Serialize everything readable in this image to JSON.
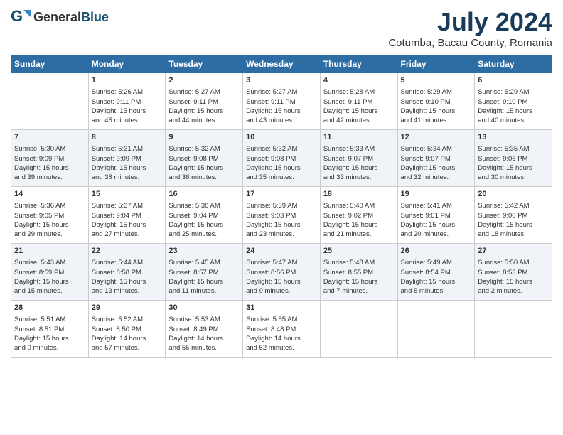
{
  "header": {
    "logo_general": "General",
    "logo_blue": "Blue",
    "title": "July 2024",
    "location": "Cotumba, Bacau County, Romania"
  },
  "days_of_week": [
    "Sunday",
    "Monday",
    "Tuesday",
    "Wednesday",
    "Thursday",
    "Friday",
    "Saturday"
  ],
  "weeks": [
    [
      {
        "day": "",
        "content": ""
      },
      {
        "day": "1",
        "content": "Sunrise: 5:26 AM\nSunset: 9:11 PM\nDaylight: 15 hours\nand 45 minutes."
      },
      {
        "day": "2",
        "content": "Sunrise: 5:27 AM\nSunset: 9:11 PM\nDaylight: 15 hours\nand 44 minutes."
      },
      {
        "day": "3",
        "content": "Sunrise: 5:27 AM\nSunset: 9:11 PM\nDaylight: 15 hours\nand 43 minutes."
      },
      {
        "day": "4",
        "content": "Sunrise: 5:28 AM\nSunset: 9:11 PM\nDaylight: 15 hours\nand 42 minutes."
      },
      {
        "day": "5",
        "content": "Sunrise: 5:29 AM\nSunset: 9:10 PM\nDaylight: 15 hours\nand 41 minutes."
      },
      {
        "day": "6",
        "content": "Sunrise: 5:29 AM\nSunset: 9:10 PM\nDaylight: 15 hours\nand 40 minutes."
      }
    ],
    [
      {
        "day": "7",
        "content": "Sunrise: 5:30 AM\nSunset: 9:09 PM\nDaylight: 15 hours\nand 39 minutes."
      },
      {
        "day": "8",
        "content": "Sunrise: 5:31 AM\nSunset: 9:09 PM\nDaylight: 15 hours\nand 38 minutes."
      },
      {
        "day": "9",
        "content": "Sunrise: 5:32 AM\nSunset: 9:08 PM\nDaylight: 15 hours\nand 36 minutes."
      },
      {
        "day": "10",
        "content": "Sunrise: 5:32 AM\nSunset: 9:08 PM\nDaylight: 15 hours\nand 35 minutes."
      },
      {
        "day": "11",
        "content": "Sunrise: 5:33 AM\nSunset: 9:07 PM\nDaylight: 15 hours\nand 33 minutes."
      },
      {
        "day": "12",
        "content": "Sunrise: 5:34 AM\nSunset: 9:07 PM\nDaylight: 15 hours\nand 32 minutes."
      },
      {
        "day": "13",
        "content": "Sunrise: 5:35 AM\nSunset: 9:06 PM\nDaylight: 15 hours\nand 30 minutes."
      }
    ],
    [
      {
        "day": "14",
        "content": "Sunrise: 5:36 AM\nSunset: 9:05 PM\nDaylight: 15 hours\nand 29 minutes."
      },
      {
        "day": "15",
        "content": "Sunrise: 5:37 AM\nSunset: 9:04 PM\nDaylight: 15 hours\nand 27 minutes."
      },
      {
        "day": "16",
        "content": "Sunrise: 5:38 AM\nSunset: 9:04 PM\nDaylight: 15 hours\nand 25 minutes."
      },
      {
        "day": "17",
        "content": "Sunrise: 5:39 AM\nSunset: 9:03 PM\nDaylight: 15 hours\nand 23 minutes."
      },
      {
        "day": "18",
        "content": "Sunrise: 5:40 AM\nSunset: 9:02 PM\nDaylight: 15 hours\nand 21 minutes."
      },
      {
        "day": "19",
        "content": "Sunrise: 5:41 AM\nSunset: 9:01 PM\nDaylight: 15 hours\nand 20 minutes."
      },
      {
        "day": "20",
        "content": "Sunrise: 5:42 AM\nSunset: 9:00 PM\nDaylight: 15 hours\nand 18 minutes."
      }
    ],
    [
      {
        "day": "21",
        "content": "Sunrise: 5:43 AM\nSunset: 8:59 PM\nDaylight: 15 hours\nand 15 minutes."
      },
      {
        "day": "22",
        "content": "Sunrise: 5:44 AM\nSunset: 8:58 PM\nDaylight: 15 hours\nand 13 minutes."
      },
      {
        "day": "23",
        "content": "Sunrise: 5:45 AM\nSunset: 8:57 PM\nDaylight: 15 hours\nand 11 minutes."
      },
      {
        "day": "24",
        "content": "Sunrise: 5:47 AM\nSunset: 8:56 PM\nDaylight: 15 hours\nand 9 minutes."
      },
      {
        "day": "25",
        "content": "Sunrise: 5:48 AM\nSunset: 8:55 PM\nDaylight: 15 hours\nand 7 minutes."
      },
      {
        "day": "26",
        "content": "Sunrise: 5:49 AM\nSunset: 8:54 PM\nDaylight: 15 hours\nand 5 minutes."
      },
      {
        "day": "27",
        "content": "Sunrise: 5:50 AM\nSunset: 8:53 PM\nDaylight: 15 hours\nand 2 minutes."
      }
    ],
    [
      {
        "day": "28",
        "content": "Sunrise: 5:51 AM\nSunset: 8:51 PM\nDaylight: 15 hours\nand 0 minutes."
      },
      {
        "day": "29",
        "content": "Sunrise: 5:52 AM\nSunset: 8:50 PM\nDaylight: 14 hours\nand 57 minutes."
      },
      {
        "day": "30",
        "content": "Sunrise: 5:53 AM\nSunset: 8:49 PM\nDaylight: 14 hours\nand 55 minutes."
      },
      {
        "day": "31",
        "content": "Sunrise: 5:55 AM\nSunset: 8:48 PM\nDaylight: 14 hours\nand 52 minutes."
      },
      {
        "day": "",
        "content": ""
      },
      {
        "day": "",
        "content": ""
      },
      {
        "day": "",
        "content": ""
      }
    ]
  ]
}
